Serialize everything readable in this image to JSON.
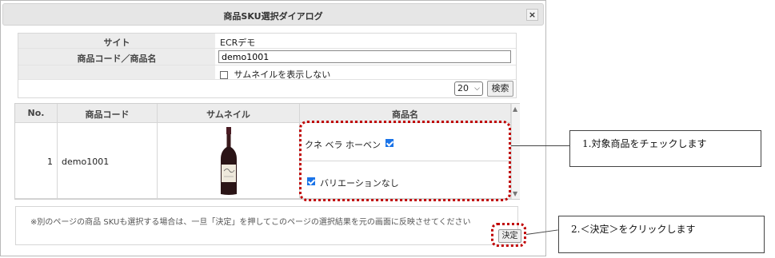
{
  "dialog": {
    "title": "商品SKU選択ダイアログ",
    "close_label": "×"
  },
  "form": {
    "site_label": "サイト",
    "site_value": "ECRデモ",
    "code_label": "商品コード／商品名",
    "code_value": "demo1001",
    "hide_thumb_label": "サムネイルを表示しない",
    "page_size": "20",
    "search_label": "検索"
  },
  "table": {
    "headers": [
      "No.",
      "商品コード",
      "サムネイル",
      "商品名"
    ],
    "row": {
      "no": "1",
      "code": "demo1001",
      "name": "クネ ベラ ホーベン",
      "variant": "バリエーションなし"
    }
  },
  "footer": {
    "note": "※別のページの商品 SKUも選択する場合は、一旦「決定」を押してこのページの選択結果を元の画面に反映させてください",
    "decide_label": "決定"
  },
  "callouts": {
    "check": "1.対象商品をチェックします",
    "decide": "2.＜決定＞をクリックします"
  },
  "colors": {
    "highlight": "#c00000",
    "checkbox": "#1a73e8"
  }
}
